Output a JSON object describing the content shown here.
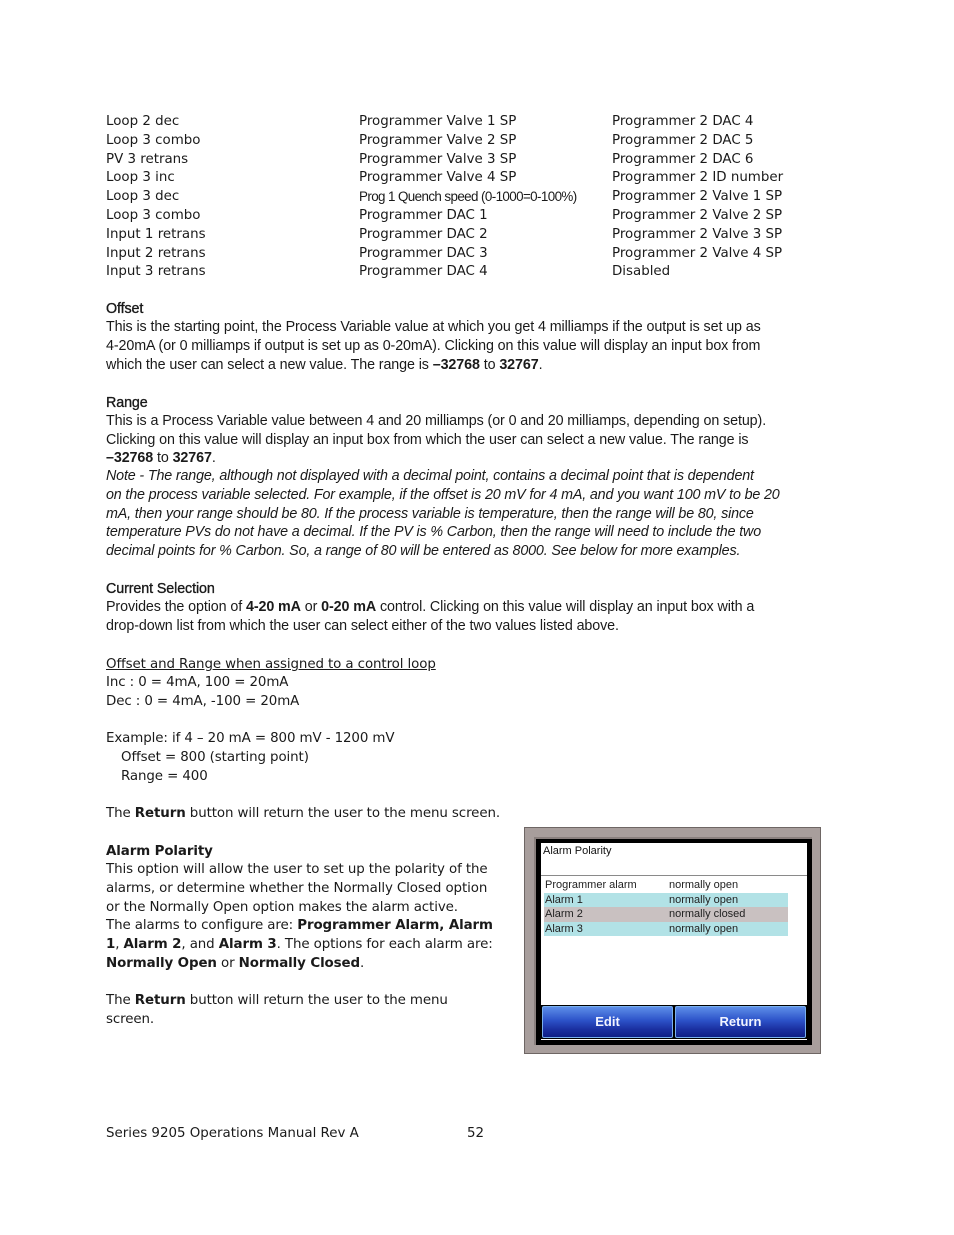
{
  "options_table": {
    "columns": [
      [
        "Loop 2 dec",
        "Loop 3 combo",
        "PV 3 retrans",
        "Loop 3 inc",
        "Loop 3 dec",
        "Loop 3 combo",
        "Input 1 retrans",
        "Input 2 retrans",
        "Input 3 retrans"
      ],
      [
        "Programmer Valve 1 SP",
        "Programmer Valve 2 SP",
        "Programmer Valve 3 SP",
        "Programmer Valve 4 SP",
        "Prog 1 Quench speed (0-1000=0-100%)",
        "Programmer DAC 1",
        "Programmer DAC 2",
        "Programmer DAC 3",
        "Programmer DAC 4"
      ],
      [
        "Programmer 2 DAC 4",
        "Programmer 2 DAC 5",
        "Programmer 2 DAC 6",
        "Programmer 2 ID number",
        "Programmer 2 Valve 1 SP",
        "Programmer 2 Valve 2 SP",
        "Programmer 2 Valve 3 SP",
        "Programmer 2 Valve 4 SP",
        "Disabled"
      ]
    ]
  },
  "offset": {
    "heading": "Offset",
    "line1": "This is the starting point, the Process Variable value at which you get 4 milliamps if the output is set up as",
    "line2": "4-20mA (or 0 milliamps if output is set up as 0-20mA).  Clicking on this value will display an input box from",
    "line3_pre": "which the user can select a new value.  The range is ",
    "min": "–32768",
    "to": " to ",
    "max": "32767",
    "end": "."
  },
  "range": {
    "heading": "Range",
    "line1": "This is a Process Variable value between 4 and 20 milliamps (or 0 and 20 milliamps, depending on setup).",
    "line2": "Clicking on this value will display an input box from which the user can select a new value.  The range is",
    "min": "–32768",
    "to": " to ",
    "max": "32767",
    "end": ".",
    "note": [
      "Note - The range, although not displayed with a decimal point, contains a decimal point that is dependent",
      "on the process variable selected. For example, if the offset is 20 mV for 4 mA, and you want 100 mV to be 20",
      "mA, then your range should be 80. If the process variable is temperature, then the range will be 80, since",
      "temperature PVs do not have a decimal. If the PV is % Carbon, then the range will need to include the two",
      "decimal points for % Carbon. So, a range of 80 will be entered as 8000. See below for more examples."
    ]
  },
  "current_selection": {
    "heading": "Current Selection",
    "pre": "Provides the option of ",
    "opt1": "4-20 mA",
    "or": " or ",
    "opt2": "0-20 mA",
    "post": " control.  Clicking on this value will display an input box with a",
    "line2": "drop-down list from which the user can select either of the two values listed above."
  },
  "control_loop": {
    "heading": "Offset and Range when assigned to a control loop",
    "inc": "Inc : 0 = 4mA, 100 = 20mA",
    "dec": "Dec : 0 = 4mA, -100 = 20mA",
    "example": "Example: if 4 – 20 mA = 800 mV  - 1200 mV",
    "example_offset": "Offset  = 800 (starting point)",
    "example_range": "Range = 400",
    "return_pre": "The ",
    "return_bold": "Return",
    "return_post": " button will return the user to the menu screen."
  },
  "alarm_polarity": {
    "heading": "Alarm Polarity",
    "lines": [
      "This option will allow the user to set up the polarity of the",
      "alarms, or determine whether the Normally Closed option",
      "or the Normally Open option makes the alarm active."
    ],
    "configure_pre": "The alarms to configure are: ",
    "configure_bold1": "Programmer Alarm, Alarm",
    "configure_bold2": "1",
    "comma1": ", ",
    "configure_bold3": "Alarm 2",
    "and": ", and ",
    "configure_bold4": "Alarm 3",
    "options_post": ".  The options for each alarm are:",
    "opt_open": "Normally Open",
    "or": " or ",
    "opt_closed": "Normally Closed",
    "period": ".",
    "return_pre": "The ",
    "return_bold": "Return",
    "return_post": " button will return the user to the menu",
    "return_line2": "screen."
  },
  "screenshot": {
    "title": "Alarm Polarity",
    "rows": [
      {
        "name": "Programmer alarm",
        "value": "normally open"
      },
      {
        "name": "Alarm 1",
        "value": "normally open"
      },
      {
        "name": "Alarm 2",
        "value": "normally closed"
      },
      {
        "name": "Alarm 3",
        "value": "normally open"
      }
    ],
    "edit_button": "Edit",
    "return_button": "Return",
    "colors": {
      "row_highlight": "#b2e2e6",
      "row_selected": "#c9c1c1",
      "button_blue": "#1a2fa0",
      "bezel": "#a89e9c"
    }
  },
  "footer": {
    "title": "Series 9205 Operations Manual Rev A",
    "page_number": "52"
  }
}
